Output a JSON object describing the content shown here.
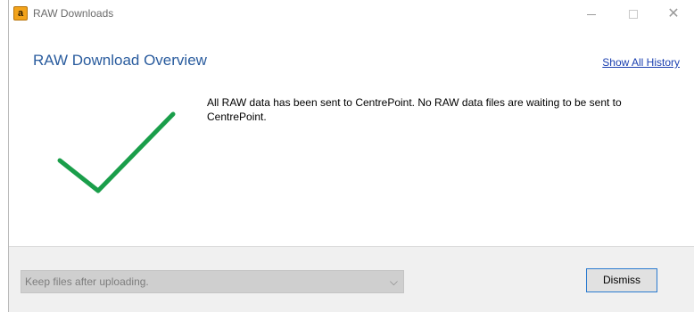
{
  "window": {
    "title": "RAW Downloads",
    "app_icon_letter": "a"
  },
  "main": {
    "heading": "RAW Download Overview",
    "history_link": "Show All History",
    "message": "All RAW data has been sent to CentrePoint.  No RAW data files are waiting to be sent to CentrePoint.",
    "status_icon": "check-icon",
    "check_color": "#1a9e4a"
  },
  "footer": {
    "keep_files_select": "Keep files after uploading.",
    "dismiss_label": "Dismiss"
  },
  "colors": {
    "heading": "#2a5c9e",
    "link": "#1a3fb0",
    "footer_bg": "#f0f0f0"
  }
}
